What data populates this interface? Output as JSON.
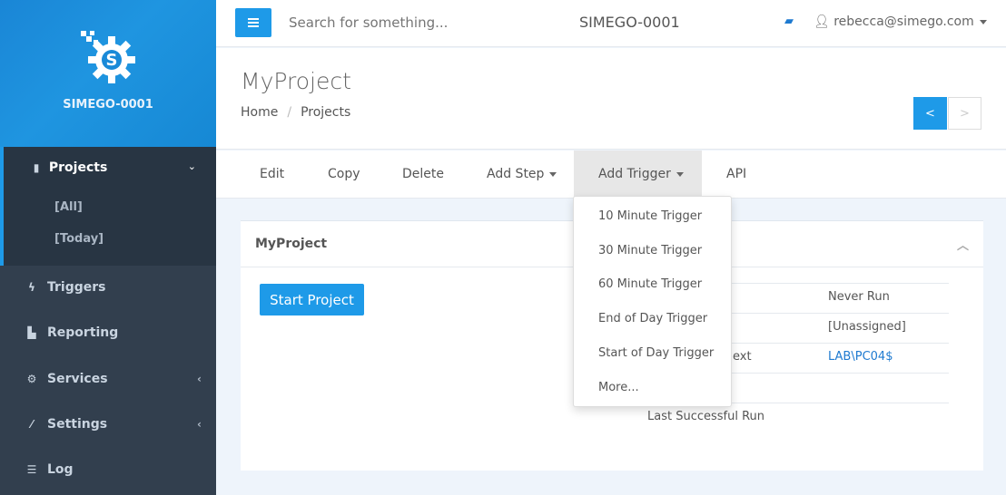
{
  "brand": {
    "name": "SIMEGO-0001"
  },
  "sidebar": {
    "projects": {
      "label": "Projects",
      "items": [
        {
          "label": "[All]"
        },
        {
          "label": "[Today]"
        }
      ]
    },
    "items": [
      {
        "label": "Triggers",
        "icon": "bolt-icon"
      },
      {
        "label": "Reporting",
        "icon": "bar-chart-icon"
      },
      {
        "label": "Services",
        "icon": "cogs-icon"
      },
      {
        "label": "Settings",
        "icon": "magic-wand-icon"
      },
      {
        "label": "Log",
        "icon": "list-icon"
      }
    ]
  },
  "topbar": {
    "search_placeholder": "Search for something...",
    "title": "SIMEGO-0001",
    "user": "rebecca@simego.com"
  },
  "page": {
    "title": "MyProject",
    "breadcrumb": [
      "Home",
      "Projects"
    ],
    "prev": "<",
    "next": ">"
  },
  "toolbar": {
    "items": [
      "Edit",
      "Copy",
      "Delete",
      "Add Step",
      "Add Trigger",
      "API"
    ]
  },
  "panel": {
    "title": "MyProject",
    "start_label": "Start Project",
    "rows": [
      {
        "label": "",
        "value": "Never Run"
      },
      {
        "label": "",
        "value": "[Unassigned]"
      },
      {
        "label": "ext",
        "value": "LAB\\PC04$"
      },
      {
        "label": "",
        "value": ""
      },
      {
        "label": "Last Successful Run",
        "value": ""
      }
    ]
  },
  "dropdown": {
    "items": [
      "10 Minute Trigger",
      "30 Minute Trigger",
      "60 Minute Trigger",
      "End of Day Trigger",
      "Start of Day Trigger",
      "More..."
    ]
  },
  "colors": {
    "accent": "#1e9ae8",
    "sidebar": "#323f4e",
    "link": "#1e7ad0"
  }
}
